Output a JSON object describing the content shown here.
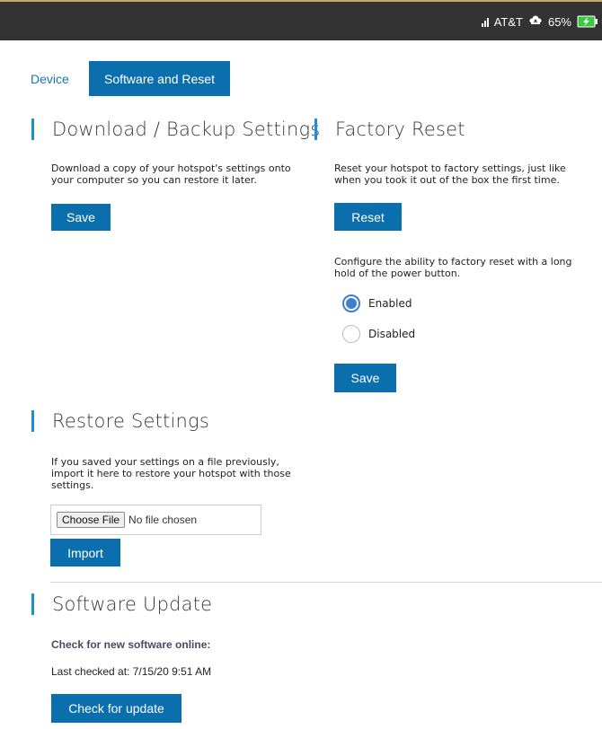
{
  "status_bar": {
    "carrier": "AT&T",
    "battery": "65%",
    "icons": [
      "signal-icon",
      "wifi-hotspot-icon",
      "battery-charging-icon"
    ]
  },
  "tabs": {
    "device": "Device",
    "software_and_reset": "Software and Reset",
    "active": "software_and_reset"
  },
  "download_backup": {
    "heading": "Download / Backup Settings",
    "description_line1": "Download a copy of your hotspot's settings onto",
    "description_line2": "your computer so you can restore it later.",
    "save_label": "Save"
  },
  "factory_reset": {
    "heading": "Factory Reset",
    "description_line1": "Reset your hotspot to factory settings, just like",
    "description_line2": "when you took it out of the box the first time.",
    "reset_label": "Reset",
    "config_line1": "Configure the ability to factory reset with a long",
    "config_line2": "hold of the power button.",
    "options": [
      {
        "label": "Enabled",
        "selected": true
      },
      {
        "label": "Disabled",
        "selected": false
      }
    ],
    "save_label": "Save"
  },
  "restore": {
    "heading": "Restore Settings",
    "description_line1": "If you saved your settings on a file previously,",
    "description_line2": "import it here to restore your hotspot with those",
    "description_line3": "settings.",
    "choose_file_label": "Choose File",
    "file_status": "No file chosen",
    "import_label": "Import"
  },
  "software_update": {
    "heading": "Software Update",
    "check_online_label": "Check for new software online:",
    "last_checked": "Last checked at: 7/15/20 9:51 AM",
    "check_button_label": "Check for update"
  },
  "colors": {
    "accent": "#0b6fae",
    "heading_bar": "#1e8fd0",
    "status_bar": "#333333",
    "radio_selected": "#3f7fcf"
  }
}
